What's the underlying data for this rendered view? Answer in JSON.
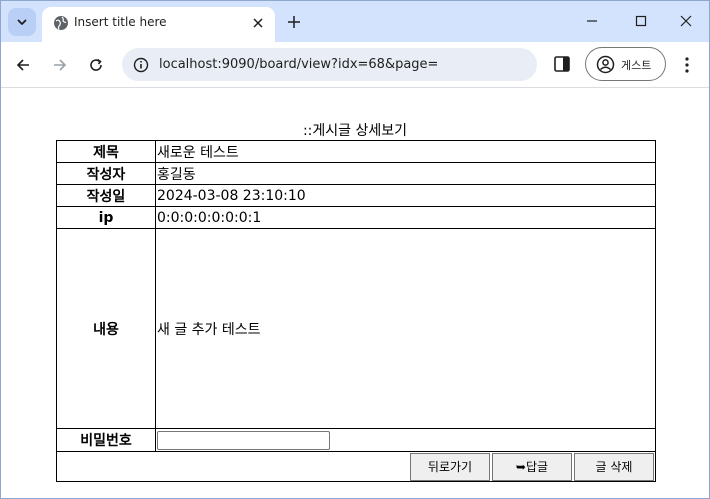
{
  "browser": {
    "tab_title": "Insert title here",
    "url": "localhost:9090/board/view?idx=68&page=",
    "profile_label": "게스트"
  },
  "page": {
    "heading": "::게시글 상세보기",
    "labels": {
      "title": "제목",
      "writer": "작성자",
      "date": "작성일",
      "ip": "ip",
      "content": "내용",
      "password": "비밀번호"
    },
    "values": {
      "title": "새로운 테스트",
      "writer": "홍길동",
      "date": "2024-03-08 23:10:10",
      "ip": "0:0:0:0:0:0:0:1",
      "content": "새 글 추가 테스트",
      "password": ""
    },
    "buttons": {
      "back": "뒤로가기",
      "reply": "➥답글",
      "delete": "글 삭제"
    }
  }
}
